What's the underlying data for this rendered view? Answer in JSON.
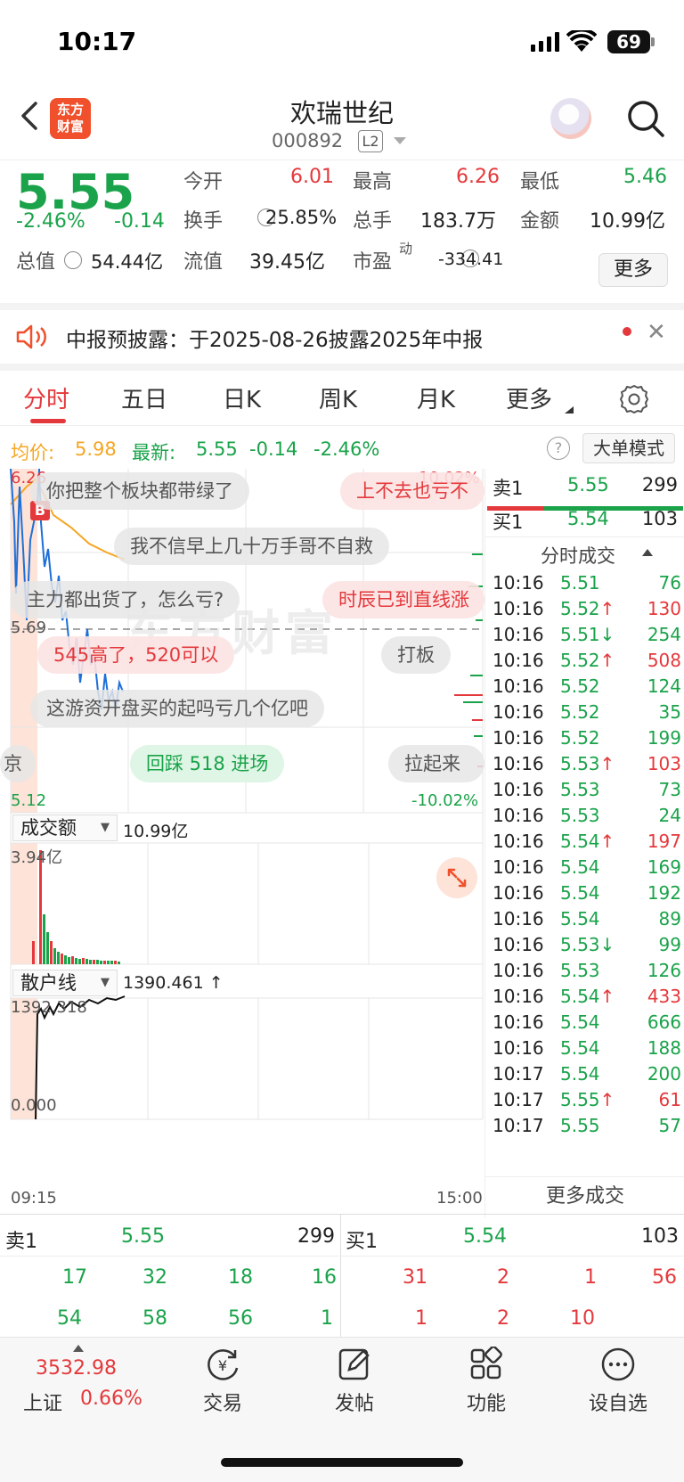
{
  "status_bar": {
    "time": "10:17",
    "battery": "69"
  },
  "header": {
    "brand_line1": "东方",
    "brand_line2": "财富",
    "stock_name": "欢瑞世纪",
    "stock_code": "000892",
    "level_badge": "L2"
  },
  "quote": {
    "price": "5.55",
    "change_pct": "-2.46%",
    "change": "-0.14",
    "open_label": "今开",
    "open": "6.01",
    "high_label": "最高",
    "high": "6.26",
    "low_label": "最低",
    "low": "5.46",
    "turnover_label": "换手",
    "turnover": "25.85%",
    "volume_label": "总手",
    "volume": "183.7万",
    "amount_label": "金额",
    "amount": "10.99亿",
    "mktcap_label": "总值",
    "mktcap": "54.44亿",
    "float_label": "流值",
    "float_cap": "39.45亿",
    "pe_label": "市盈",
    "pe_sup": "动",
    "pe": "-334.41",
    "more_button": "更多"
  },
  "notice": {
    "text": "中报预披露：于2025-08-26披露2025年中报"
  },
  "tabs": [
    {
      "label": "分时"
    },
    {
      "label": "五日"
    },
    {
      "label": "日K"
    },
    {
      "label": "周K"
    },
    {
      "label": "月K"
    },
    {
      "label": "更多"
    }
  ],
  "info_line": {
    "avg_label": "均价:",
    "avg": "5.98",
    "latest_label": "最新:",
    "latest": "5.55",
    "change": "-0.14",
    "change_pct": "-2.46%",
    "help": "?",
    "big_order_button": "大单模式"
  },
  "chart": {
    "price_high": "6.26",
    "price_low": "5.12",
    "prev_close": "5.69",
    "pct_up": "10.02%",
    "pct_down": "-10.02%",
    "buy_marker": "B",
    "volume_dropdown": "成交额",
    "volume_total": "10.99亿",
    "volume_max": "3.94亿",
    "retail_dropdown": "散户线",
    "retail_value": "1390.461 ↑",
    "retail_max": "1392.318",
    "retail_min": "0.000",
    "time_start": "09:15",
    "time_end": "15:00",
    "watermark": "东方财富"
  },
  "comments": [
    "你把整个板块都带绿了",
    "上不去也亏不",
    "我不信早上几十万手哥不自救",
    "主力都出货了，怎么亏?",
    "时辰已到直线涨",
    "545高了，520可以",
    "打板",
    "这游资开盘买的起吗亏几个亿吧",
    "京",
    "回踩 518 进场",
    "拉起来"
  ],
  "order_book_right": {
    "sell1_label": "卖1",
    "sell1_price": "5.55",
    "sell1_vol": "299",
    "buy1_label": "买1",
    "buy1_price": "5.54",
    "buy1_vol": "103"
  },
  "ticks_title": "分时成交",
  "ticks": [
    {
      "t": "10:16",
      "p": "5.51",
      "v": "76"
    },
    {
      "t": "10:16",
      "p": "5.52↑",
      "v": "130"
    },
    {
      "t": "10:16",
      "p": "5.51↓",
      "v": "254"
    },
    {
      "t": "10:16",
      "p": "5.52↑",
      "v": "508"
    },
    {
      "t": "10:16",
      "p": "5.52",
      "v": "124"
    },
    {
      "t": "10:16",
      "p": "5.52",
      "v": "35"
    },
    {
      "t": "10:16",
      "p": "5.52",
      "v": "199"
    },
    {
      "t": "10:16",
      "p": "5.53↑",
      "v": "103"
    },
    {
      "t": "10:16",
      "p": "5.53",
      "v": "73"
    },
    {
      "t": "10:16",
      "p": "5.53",
      "v": "24"
    },
    {
      "t": "10:16",
      "p": "5.54↑",
      "v": "197"
    },
    {
      "t": "10:16",
      "p": "5.54",
      "v": "169"
    },
    {
      "t": "10:16",
      "p": "5.54",
      "v": "192"
    },
    {
      "t": "10:16",
      "p": "5.54",
      "v": "89"
    },
    {
      "t": "10:16",
      "p": "5.53↓",
      "v": "99"
    },
    {
      "t": "10:16",
      "p": "5.53",
      "v": "126"
    },
    {
      "t": "10:16",
      "p": "5.54↑",
      "v": "433"
    },
    {
      "t": "10:16",
      "p": "5.54",
      "v": "666"
    },
    {
      "t": "10:16",
      "p": "5.54",
      "v": "188"
    },
    {
      "t": "10:17",
      "p": "5.54",
      "v": "200"
    },
    {
      "t": "10:17",
      "p": "5.55↑",
      "v": "61"
    },
    {
      "t": "10:17",
      "p": "5.55",
      "v": "57"
    }
  ],
  "more_ticks": "更多成交",
  "bottom_book": {
    "sell_label": "卖1",
    "sell_price": "5.55",
    "sell_vol": "299",
    "buy_label": "买1",
    "buy_price": "5.54",
    "buy_vol": "103",
    "sell_row1": [
      "17",
      "32",
      "18",
      "16"
    ],
    "sell_row2": [
      "54",
      "58",
      "56",
      "1"
    ],
    "buy_row1": [
      "31",
      "2",
      "1",
      "56"
    ],
    "buy_row2": [
      "1",
      "2",
      "10"
    ]
  },
  "nav": {
    "index_value": "3532.98",
    "index_name": "上证",
    "index_pct": "0.66%",
    "trade": "交易",
    "post": "发帖",
    "functions": "功能",
    "watchlist": "设自选"
  }
}
